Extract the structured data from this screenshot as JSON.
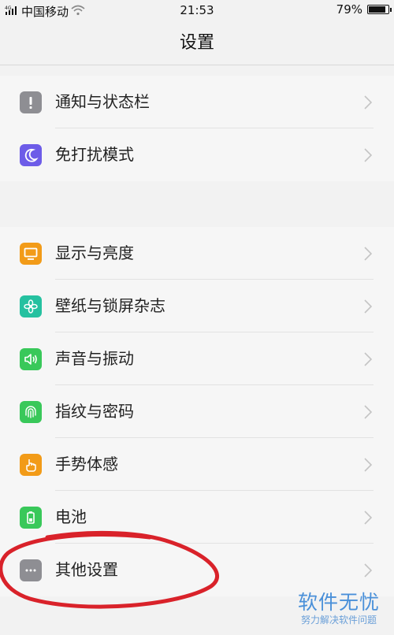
{
  "status_bar": {
    "carrier": "中国移动",
    "time": "21:53",
    "battery_percent": "79%",
    "battery_level": 0.79
  },
  "header": {
    "title": "设置"
  },
  "groups": [
    {
      "items": [
        {
          "label": "通知与状态栏",
          "icon": "exclamation-icon",
          "color": "#8e8e93"
        },
        {
          "label": "免打扰模式",
          "icon": "moon-icon",
          "color": "#6d5ce8"
        }
      ]
    },
    {
      "items": [
        {
          "label": "显示与亮度",
          "icon": "display-icon",
          "color": "#f29b18"
        },
        {
          "label": "壁纸与锁屏杂志",
          "icon": "flower-icon",
          "color": "#25c1a0"
        },
        {
          "label": "声音与振动",
          "icon": "speaker-icon",
          "color": "#39c85a"
        },
        {
          "label": "指纹与密码",
          "icon": "fingerprint-icon",
          "color": "#39c85a"
        },
        {
          "label": "手势体感",
          "icon": "hand-icon",
          "color": "#f29b18"
        },
        {
          "label": "电池",
          "icon": "battery-icon",
          "color": "#39c85a"
        },
        {
          "label": "其他设置",
          "icon": "more-icon",
          "color": "#8e8e93"
        }
      ]
    }
  ],
  "annotation_color": "#d9222a",
  "watermark": {
    "main": "软件无忧",
    "sub": "努力解决软件问题"
  }
}
